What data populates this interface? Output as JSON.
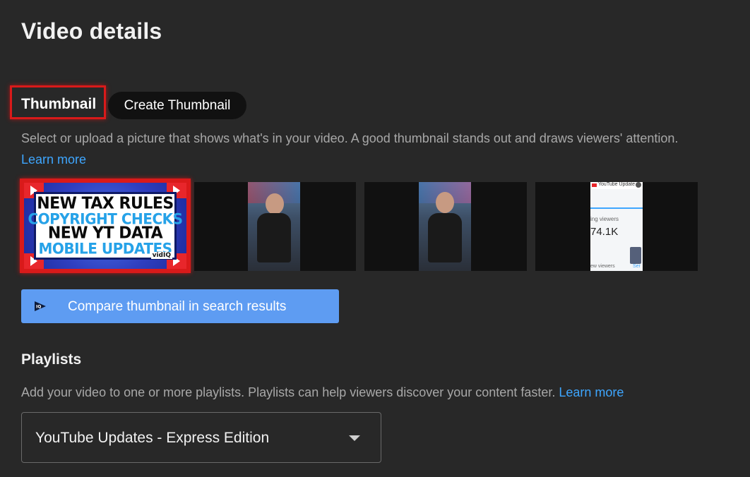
{
  "page": {
    "title": "Video details"
  },
  "thumbnail": {
    "heading": "Thumbnail",
    "create_button": "Create Thumbnail",
    "description": "Select or upload a picture that shows what's in your video. A good thumbnail stands out and draws viewers' attention.",
    "learn_more": "Learn more",
    "selected": {
      "lines": [
        "NEW TAX RULES",
        "COPYRIGHT CHECKS",
        "NEW YT DATA",
        "MOBILE UPDATES"
      ],
      "brand": "vidIQ"
    },
    "frames": [
      {
        "label": "auto-frame-1"
      },
      {
        "label": "auto-frame-2"
      },
      {
        "label": "auto-frame-3",
        "screen_title": "YouTube Update",
        "screen_label": "ing viewers",
        "screen_value": "74.1K",
        "screen_footer": "ew viewers",
        "screen_footer_right": "Ser"
      }
    ],
    "compare_button": "Compare thumbnail in search results"
  },
  "playlists": {
    "heading": "Playlists",
    "description": "Add your video to one or more playlists. Playlists can help viewers discover your content faster.",
    "learn_more": "Learn more",
    "selected_value": "YouTube Updates - Express Edition"
  },
  "colors": {
    "background": "#282828",
    "highlight": "#d91a1a",
    "link": "#3ea6ff",
    "compare_button": "#5e9cf2"
  }
}
